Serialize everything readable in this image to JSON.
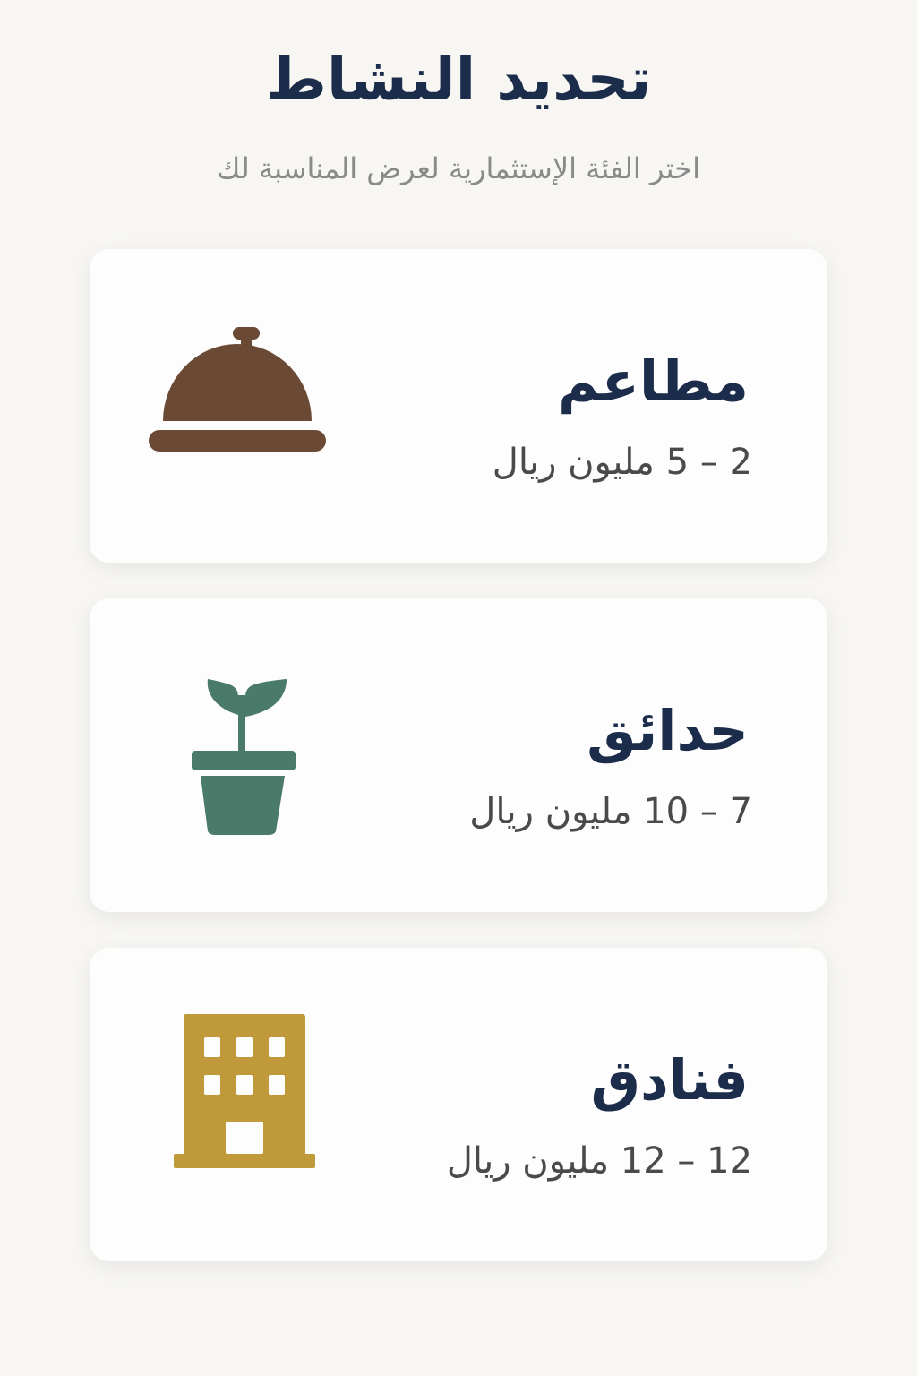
{
  "header": {
    "title": "تحديد النشاط",
    "subtitle": "اختر الفئة الإستثمارية لعرض المناسبة لك"
  },
  "categories": [
    {
      "name": "مطاعم",
      "range": "2 – 5  مليون ريال",
      "icon": "cloche-icon",
      "color": "#6b4a35"
    },
    {
      "name": "حدائق",
      "range": "7 – 10  مليون ريال",
      "icon": "plant-pot-icon",
      "color": "#4a7a69"
    },
    {
      "name": "فنادق",
      "range": "12 – 12  مليون ريال",
      "icon": "hotel-building-icon",
      "color": "#c09a3a"
    }
  ]
}
